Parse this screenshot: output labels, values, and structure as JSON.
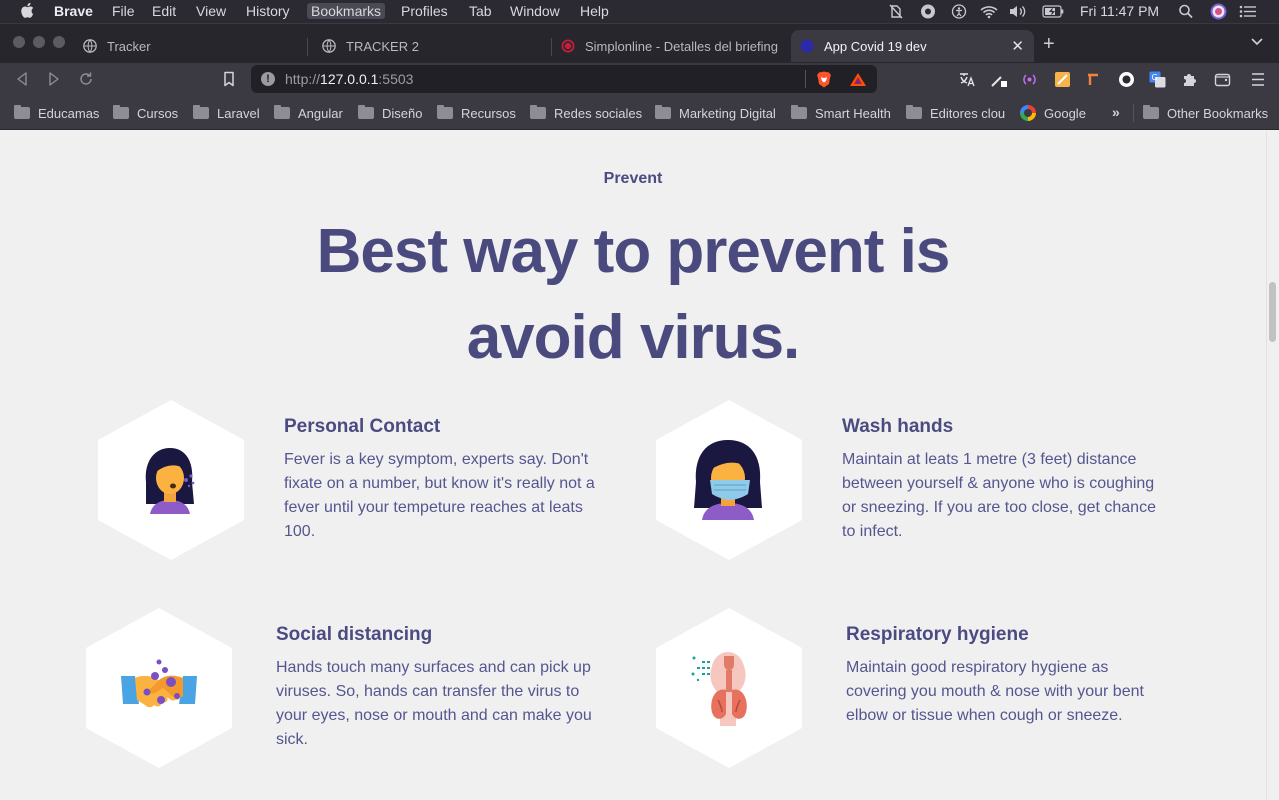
{
  "menubar": {
    "app": "Brave",
    "items": [
      "File",
      "Edit",
      "View",
      "History",
      "Bookmarks",
      "Profiles",
      "Tab",
      "Window",
      "Help"
    ],
    "active_item": "Bookmarks",
    "clock": "Fri 11:47 PM"
  },
  "tabs": [
    {
      "label": "Tracker",
      "icon": "globe-icon"
    },
    {
      "label": "TRACKER 2",
      "icon": "globe-icon"
    },
    {
      "label": "Simplonline - Detalles del briefing",
      "icon": "simplon-icon"
    },
    {
      "label": "App Covid 19 dev",
      "icon": "app-icon",
      "active": true
    }
  ],
  "toolbar": {
    "url_prefix": "http://",
    "url_host": "127.0.0.1",
    "url_suffix": ":5503"
  },
  "bookmarks": {
    "items": [
      "Educamas",
      "Cursos",
      "Laravel",
      "Angular",
      "Diseño",
      "Recursos",
      "Redes sociales",
      "Marketing Digital",
      "Smart Health",
      "Editores clou",
      "Google"
    ],
    "overflow": "»",
    "other": "Other Bookmarks"
  },
  "page": {
    "eyebrow": "Prevent",
    "headline_line1": "Best way to prevent is",
    "headline_line2": "avoid virus.",
    "cards": [
      {
        "title": "Personal Contact",
        "text": "Fever is a key symptom, experts say. Don't fixate on a number, but know it's really not a fever until your tempeture reaches at leats 100.",
        "icon": "coughing-person-icon"
      },
      {
        "title": "Wash hands",
        "text": "Maintain at leats 1 metre (3 feet) distance between yourself & anyone who is coughing or sneezing. If you are too close, get chance to infect.",
        "icon": "masked-person-icon"
      },
      {
        "title": "Social distancing",
        "text": "Hands touch many surfaces and can pick up viruses. So, hands can transfer the virus to your eyes, nose or mouth and can make you sick.",
        "icon": "handshake-icon"
      },
      {
        "title": "Respiratory hygiene",
        "text": "Maintain good respiratory hygiene as covering you mouth & nose with your bent elbow or tissue when cough or sneeze.",
        "icon": "lungs-icon"
      }
    ]
  },
  "colors": {
    "heading": "#4a4a7e",
    "text": "#555590",
    "page_bg": "#f0f0f0",
    "chrome_bg": "#3b3a42"
  }
}
